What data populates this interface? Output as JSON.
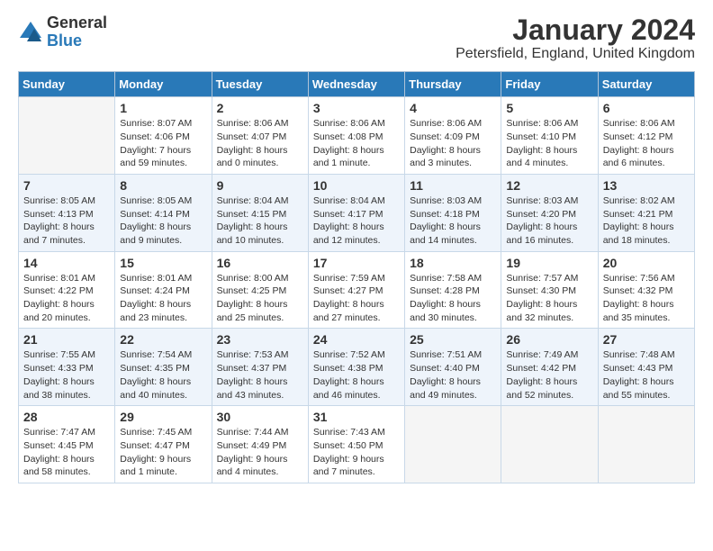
{
  "logo": {
    "general": "General",
    "blue": "Blue"
  },
  "title": "January 2024",
  "subtitle": "Petersfield, England, United Kingdom",
  "days_header": [
    "Sunday",
    "Monday",
    "Tuesday",
    "Wednesday",
    "Thursday",
    "Friday",
    "Saturday"
  ],
  "weeks": [
    [
      {
        "day": "",
        "sunrise": "",
        "sunset": "",
        "daylight": ""
      },
      {
        "day": "1",
        "sunrise": "Sunrise: 8:07 AM",
        "sunset": "Sunset: 4:06 PM",
        "daylight": "Daylight: 7 hours and 59 minutes."
      },
      {
        "day": "2",
        "sunrise": "Sunrise: 8:06 AM",
        "sunset": "Sunset: 4:07 PM",
        "daylight": "Daylight: 8 hours and 0 minutes."
      },
      {
        "day": "3",
        "sunrise": "Sunrise: 8:06 AM",
        "sunset": "Sunset: 4:08 PM",
        "daylight": "Daylight: 8 hours and 1 minute."
      },
      {
        "day": "4",
        "sunrise": "Sunrise: 8:06 AM",
        "sunset": "Sunset: 4:09 PM",
        "daylight": "Daylight: 8 hours and 3 minutes."
      },
      {
        "day": "5",
        "sunrise": "Sunrise: 8:06 AM",
        "sunset": "Sunset: 4:10 PM",
        "daylight": "Daylight: 8 hours and 4 minutes."
      },
      {
        "day": "6",
        "sunrise": "Sunrise: 8:06 AM",
        "sunset": "Sunset: 4:12 PM",
        "daylight": "Daylight: 8 hours and 6 minutes."
      }
    ],
    [
      {
        "day": "7",
        "sunrise": "Sunrise: 8:05 AM",
        "sunset": "Sunset: 4:13 PM",
        "daylight": "Daylight: 8 hours and 7 minutes."
      },
      {
        "day": "8",
        "sunrise": "Sunrise: 8:05 AM",
        "sunset": "Sunset: 4:14 PM",
        "daylight": "Daylight: 8 hours and 9 minutes."
      },
      {
        "day": "9",
        "sunrise": "Sunrise: 8:04 AM",
        "sunset": "Sunset: 4:15 PM",
        "daylight": "Daylight: 8 hours and 10 minutes."
      },
      {
        "day": "10",
        "sunrise": "Sunrise: 8:04 AM",
        "sunset": "Sunset: 4:17 PM",
        "daylight": "Daylight: 8 hours and 12 minutes."
      },
      {
        "day": "11",
        "sunrise": "Sunrise: 8:03 AM",
        "sunset": "Sunset: 4:18 PM",
        "daylight": "Daylight: 8 hours and 14 minutes."
      },
      {
        "day": "12",
        "sunrise": "Sunrise: 8:03 AM",
        "sunset": "Sunset: 4:20 PM",
        "daylight": "Daylight: 8 hours and 16 minutes."
      },
      {
        "day": "13",
        "sunrise": "Sunrise: 8:02 AM",
        "sunset": "Sunset: 4:21 PM",
        "daylight": "Daylight: 8 hours and 18 minutes."
      }
    ],
    [
      {
        "day": "14",
        "sunrise": "Sunrise: 8:01 AM",
        "sunset": "Sunset: 4:22 PM",
        "daylight": "Daylight: 8 hours and 20 minutes."
      },
      {
        "day": "15",
        "sunrise": "Sunrise: 8:01 AM",
        "sunset": "Sunset: 4:24 PM",
        "daylight": "Daylight: 8 hours and 23 minutes."
      },
      {
        "day": "16",
        "sunrise": "Sunrise: 8:00 AM",
        "sunset": "Sunset: 4:25 PM",
        "daylight": "Daylight: 8 hours and 25 minutes."
      },
      {
        "day": "17",
        "sunrise": "Sunrise: 7:59 AM",
        "sunset": "Sunset: 4:27 PM",
        "daylight": "Daylight: 8 hours and 27 minutes."
      },
      {
        "day": "18",
        "sunrise": "Sunrise: 7:58 AM",
        "sunset": "Sunset: 4:28 PM",
        "daylight": "Daylight: 8 hours and 30 minutes."
      },
      {
        "day": "19",
        "sunrise": "Sunrise: 7:57 AM",
        "sunset": "Sunset: 4:30 PM",
        "daylight": "Daylight: 8 hours and 32 minutes."
      },
      {
        "day": "20",
        "sunrise": "Sunrise: 7:56 AM",
        "sunset": "Sunset: 4:32 PM",
        "daylight": "Daylight: 8 hours and 35 minutes."
      }
    ],
    [
      {
        "day": "21",
        "sunrise": "Sunrise: 7:55 AM",
        "sunset": "Sunset: 4:33 PM",
        "daylight": "Daylight: 8 hours and 38 minutes."
      },
      {
        "day": "22",
        "sunrise": "Sunrise: 7:54 AM",
        "sunset": "Sunset: 4:35 PM",
        "daylight": "Daylight: 8 hours and 40 minutes."
      },
      {
        "day": "23",
        "sunrise": "Sunrise: 7:53 AM",
        "sunset": "Sunset: 4:37 PM",
        "daylight": "Daylight: 8 hours and 43 minutes."
      },
      {
        "day": "24",
        "sunrise": "Sunrise: 7:52 AM",
        "sunset": "Sunset: 4:38 PM",
        "daylight": "Daylight: 8 hours and 46 minutes."
      },
      {
        "day": "25",
        "sunrise": "Sunrise: 7:51 AM",
        "sunset": "Sunset: 4:40 PM",
        "daylight": "Daylight: 8 hours and 49 minutes."
      },
      {
        "day": "26",
        "sunrise": "Sunrise: 7:49 AM",
        "sunset": "Sunset: 4:42 PM",
        "daylight": "Daylight: 8 hours and 52 minutes."
      },
      {
        "day": "27",
        "sunrise": "Sunrise: 7:48 AM",
        "sunset": "Sunset: 4:43 PM",
        "daylight": "Daylight: 8 hours and 55 minutes."
      }
    ],
    [
      {
        "day": "28",
        "sunrise": "Sunrise: 7:47 AM",
        "sunset": "Sunset: 4:45 PM",
        "daylight": "Daylight: 8 hours and 58 minutes."
      },
      {
        "day": "29",
        "sunrise": "Sunrise: 7:45 AM",
        "sunset": "Sunset: 4:47 PM",
        "daylight": "Daylight: 9 hours and 1 minute."
      },
      {
        "day": "30",
        "sunrise": "Sunrise: 7:44 AM",
        "sunset": "Sunset: 4:49 PM",
        "daylight": "Daylight: 9 hours and 4 minutes."
      },
      {
        "day": "31",
        "sunrise": "Sunrise: 7:43 AM",
        "sunset": "Sunset: 4:50 PM",
        "daylight": "Daylight: 9 hours and 7 minutes."
      },
      {
        "day": "",
        "sunrise": "",
        "sunset": "",
        "daylight": ""
      },
      {
        "day": "",
        "sunrise": "",
        "sunset": "",
        "daylight": ""
      },
      {
        "day": "",
        "sunrise": "",
        "sunset": "",
        "daylight": ""
      }
    ]
  ]
}
